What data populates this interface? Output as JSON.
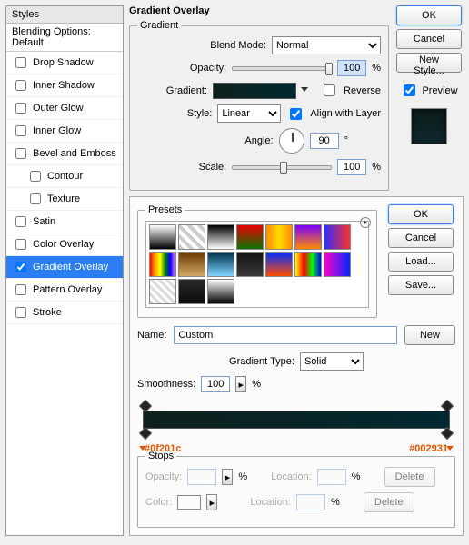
{
  "styles_panel": {
    "header": "Styles",
    "blending_options": "Blending Options: Default",
    "items": [
      {
        "label": "Drop Shadow",
        "checked": false,
        "indent": false
      },
      {
        "label": "Inner Shadow",
        "checked": false,
        "indent": false
      },
      {
        "label": "Outer Glow",
        "checked": false,
        "indent": false
      },
      {
        "label": "Inner Glow",
        "checked": false,
        "indent": false
      },
      {
        "label": "Bevel and Emboss",
        "checked": false,
        "indent": false
      },
      {
        "label": "Contour",
        "checked": false,
        "indent": true
      },
      {
        "label": "Texture",
        "checked": false,
        "indent": true
      },
      {
        "label": "Satin",
        "checked": false,
        "indent": false
      },
      {
        "label": "Color Overlay",
        "checked": false,
        "indent": false
      },
      {
        "label": "Gradient Overlay",
        "checked": true,
        "indent": false,
        "selected": true
      },
      {
        "label": "Pattern Overlay",
        "checked": false,
        "indent": false
      },
      {
        "label": "Stroke",
        "checked": false,
        "indent": false
      }
    ]
  },
  "section_title": "Gradient Overlay",
  "gradient": {
    "legend": "Gradient",
    "blend_mode_label": "Blend Mode:",
    "blend_mode_value": "Normal",
    "opacity_label": "Opacity:",
    "opacity_value": "100",
    "opacity_unit": "%",
    "gradient_label": "Gradient:",
    "reverse_label": "Reverse",
    "reverse_checked": false,
    "style_label": "Style:",
    "style_value": "Linear",
    "align_label": "Align with Layer",
    "align_checked": true,
    "angle_label": "Angle:",
    "angle_value": "90",
    "angle_unit": "°",
    "scale_label": "Scale:",
    "scale_value": "100",
    "scale_unit": "%"
  },
  "buttons1": {
    "ok": "OK",
    "cancel": "Cancel",
    "new_style": "New Style...",
    "preview": "Preview"
  },
  "editor": {
    "presets_legend": "Presets",
    "ok": "OK",
    "cancel": "Cancel",
    "load": "Load...",
    "save": "Save...",
    "name_label": "Name:",
    "name_value": "Custom",
    "new": "New",
    "type_label": "Gradient Type:",
    "type_value": "Solid",
    "smooth_label": "Smoothness:",
    "smooth_value": "100",
    "smooth_unit": "%",
    "hex_left": "#0f201c",
    "hex_right": "#002931",
    "stops_legend": "Stops",
    "stop_opacity_label": "Opacity:",
    "stop_opacity_unit": "%",
    "stop_loc_label": "Location:",
    "stop_loc_unit": "%",
    "stop_color_label": "Color:",
    "delete": "Delete"
  },
  "preset_swatches": [
    "linear-gradient(#fff,#000)",
    "repeating-linear-gradient(45deg,#ccc 0 4px,#fff 4px 8px)",
    "linear-gradient(#000,#fff)",
    "linear-gradient(#e80000,#0b7500)",
    "linear-gradient(90deg,#ff8a00,#ffde00,#ff8a00)",
    "linear-gradient(#7a00ff,#ff8a00)",
    "linear-gradient(90deg,#2e2eff,#ff2e2e)",
    "linear-gradient(90deg,red,orange,yellow,green,blue,violet)",
    "linear-gradient(#6b3a00,#d1a866)",
    "linear-gradient(#00304a,#7fd4ff)",
    "linear-gradient(#121212,#3a3a3a)",
    "linear-gradient(#002dff,#ff4d00)",
    "linear-gradient(90deg,#ff0,#f00,#0f0,#00f)",
    "linear-gradient(90deg,#ff00c8,#0028ff)",
    "repeating-linear-gradient(45deg,#ddd 0 3px,#fff 3px 6px)",
    "linear-gradient(#2a2a2a,#0a0a0a)",
    "linear-gradient(#ffffff,#000000)"
  ]
}
